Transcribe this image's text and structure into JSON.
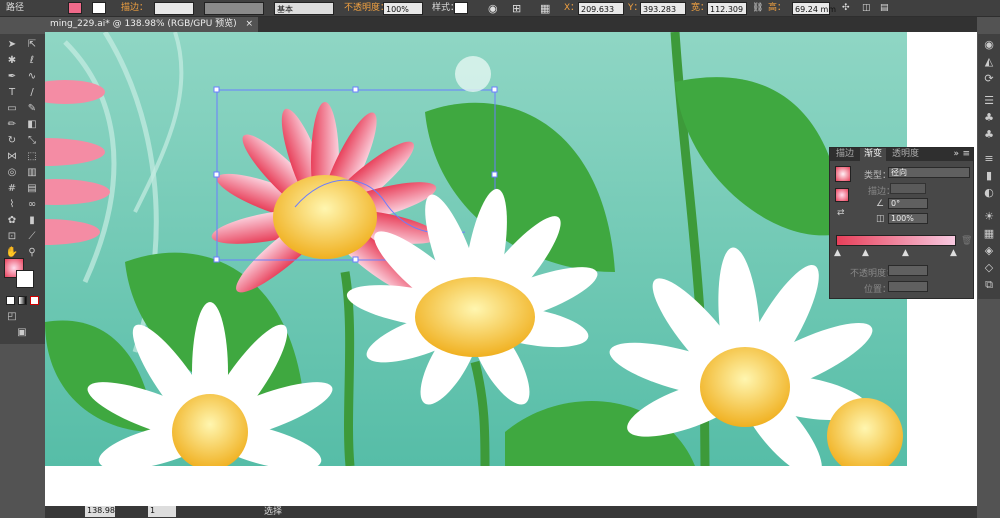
{
  "control_bar": {
    "object_type": "路径",
    "stroke_label": "描边：",
    "stroke_profile": "基本",
    "opacity_label": "不透明度：",
    "opacity_value": "100%",
    "style_label": "样式：",
    "x_label": "X：",
    "x_value": "209.633",
    "y_label": "Y：",
    "y_value": "393.283",
    "w_label": "宽：",
    "w_value": "112.309",
    "h_label": "高：",
    "h_value": "69.24 mm"
  },
  "document": {
    "tab_title": "ming_229.ai* @ 138.98% (RGB/GPU 预览)",
    "close_glyph": "×"
  },
  "status_bar": {
    "zoom": "138.98",
    "page": "1",
    "tool_status": "选择"
  },
  "gradient_panel": {
    "tabs": [
      "描边",
      "渐变",
      "透明度"
    ],
    "active_tab": "渐变",
    "type_label": "类型：",
    "type_value": "径向",
    "stroke_label": "描边：",
    "angle_value": "0°",
    "ratio_value": "100%",
    "opacity_label": "不透明度：",
    "location_label": "位置："
  },
  "colors": {
    "accent_orange": "#f0a040",
    "gradient_start": "#e8405a",
    "gradient_end": "#f7c9e0",
    "bg_top": "#8fd6c4",
    "bg_bottom": "#56bda7"
  },
  "icons": {
    "tools": [
      "selection-icon",
      "direct-selection-icon",
      "magic-wand-icon",
      "lasso-icon",
      "pen-icon",
      "curvature-icon",
      "type-icon",
      "line-icon",
      "rectangle-icon",
      "paintbrush-icon",
      "pencil-icon",
      "eraser-icon",
      "rotate-icon",
      "scale-icon",
      "width-icon",
      "free-transform-icon",
      "shape-builder-icon",
      "perspective-icon",
      "mesh-icon",
      "gradient-icon",
      "eyedropper-icon",
      "blend-icon",
      "symbol-sprayer-icon",
      "graph-icon",
      "artboard-icon",
      "slice-icon",
      "hand-icon",
      "zoom-icon"
    ],
    "right_panel": [
      "appearance-icon",
      "graphic-styles-icon",
      "transform-icon",
      "align-icon",
      "brushes-icon",
      "symbols-icon",
      "stroke-icon",
      "gradient-panel-icon",
      "transparency-icon",
      "color-icon",
      "swatches-icon",
      "layers-icon",
      "artboards-icon",
      "links-icon",
      "document-info-icon"
    ]
  }
}
